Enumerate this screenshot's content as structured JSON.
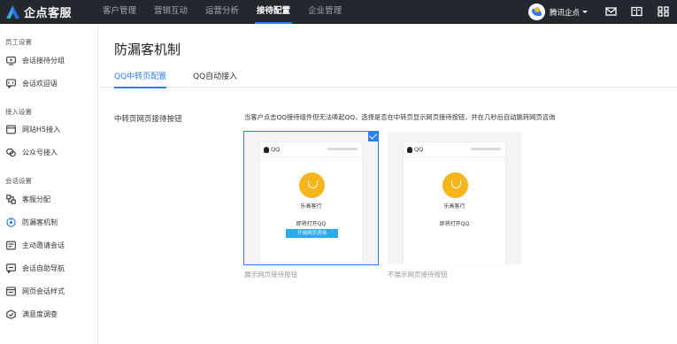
{
  "header": {
    "logo_text": "企点客服",
    "nav": [
      "客户管理",
      "营销互动",
      "运营分析",
      "接待配置",
      "企业管理"
    ],
    "active_nav": "接待配置",
    "org_name": "腾讯企点",
    "icons": [
      "mail-icon",
      "book-icon",
      "grid-icon"
    ]
  },
  "sidebar": {
    "groups": [
      {
        "title": "员工设置",
        "items": [
          {
            "label": "会话接待分组",
            "icon": "group-icon"
          },
          {
            "label": "会话欢迎语",
            "icon": "chat-icon"
          }
        ]
      },
      {
        "title": "接入设置",
        "items": [
          {
            "label": "网站H5接入",
            "icon": "web-icon"
          },
          {
            "label": "公众号接入",
            "icon": "wechat-icon"
          }
        ]
      },
      {
        "title": "会话设置",
        "items": [
          {
            "label": "客服分配",
            "icon": "assign-icon"
          },
          {
            "label": "防漏客机制",
            "icon": "shield-icon"
          },
          {
            "label": "主动邀请会话",
            "icon": "invite-icon"
          },
          {
            "label": "会话自助导航",
            "icon": "nav-icon"
          },
          {
            "label": "网页会话样式",
            "icon": "style-icon"
          },
          {
            "label": "满意度调查",
            "icon": "survey-icon"
          }
        ]
      }
    ],
    "active_item": "防漏客机制"
  },
  "main": {
    "title": "防漏客机制",
    "tabs": [
      "QQ中转页配置",
      "QQ自动接入"
    ],
    "active_tab": "QQ中转页配置",
    "field_label": "中转页网页接待按钮",
    "field_desc": "当客户点击QQ接待组件但无法唤起QQ，选择是否在中转页显示网页接待按钮，并在几秒后自动跳转网页咨询",
    "options": [
      {
        "caption": "展示网页接待按钮",
        "selected": true,
        "phone": {
          "title": "QQ",
          "name": "乐高客行",
          "open_text": "即将打开QQ",
          "button": "开始网页咨询"
        }
      },
      {
        "caption": "不展示网页接待按钮",
        "selected": false,
        "phone": {
          "title": "QQ",
          "name": "乐高客行",
          "open_text": "即将打开QQ",
          "button": ""
        }
      }
    ],
    "accent_color": "#2b7df0"
  }
}
